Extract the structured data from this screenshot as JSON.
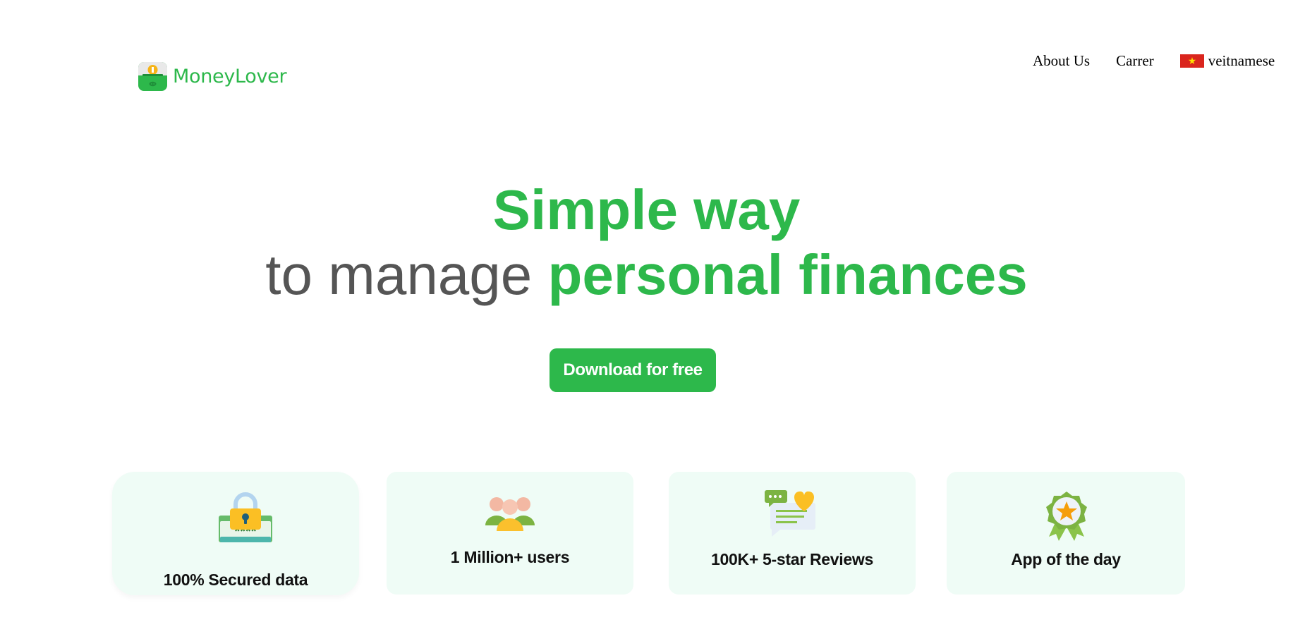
{
  "header": {
    "brand": "MoneyLover",
    "nav": {
      "about": "About Us",
      "career": "Carrer",
      "language": "veitnamese"
    }
  },
  "hero": {
    "line1": "Simple way",
    "line2_prefix": "to manage ",
    "line2_highlight": "personal finances",
    "cta_label": "Download for free"
  },
  "features": [
    {
      "icon": "lock-icon",
      "label": "100% Secured data"
    },
    {
      "icon": "users-icon",
      "label": "1 Million+ users"
    },
    {
      "icon": "reviews-icon",
      "label": "100K+ 5-star Reviews"
    },
    {
      "icon": "award-icon",
      "label": "App of the day"
    }
  ],
  "colors": {
    "brand_green": "#2db84b",
    "card_bg": "#effcf6",
    "heading_gray": "#555555"
  }
}
